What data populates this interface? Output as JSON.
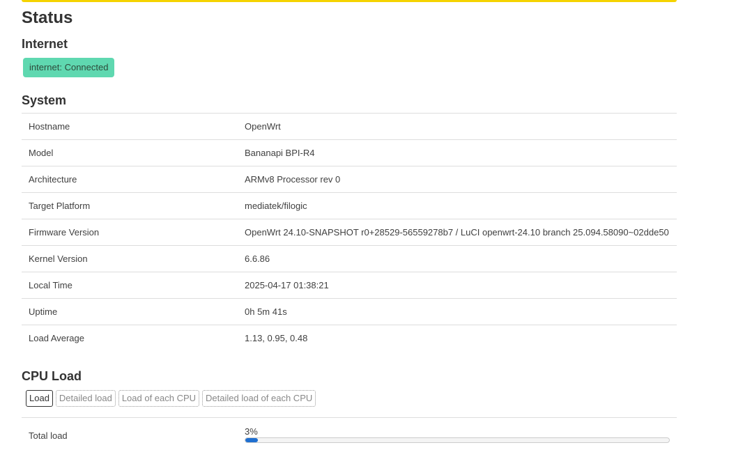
{
  "page": {
    "title": "Status"
  },
  "internet": {
    "heading": "Internet",
    "badge": "internet: Connected",
    "badge_color": "#5fd8b0"
  },
  "system": {
    "heading": "System",
    "rows": [
      {
        "key": "Hostname",
        "value": "OpenWrt"
      },
      {
        "key": "Model",
        "value": "Bananapi BPI-R4"
      },
      {
        "key": "Architecture",
        "value": "ARMv8 Processor rev 0"
      },
      {
        "key": "Target Platform",
        "value": "mediatek/filogic"
      },
      {
        "key": "Firmware Version",
        "value": "OpenWrt 24.10-SNAPSHOT r0+28529-56559278b7 / LuCI openwrt-24.10 branch 25.094.58090~02dde50"
      },
      {
        "key": "Kernel Version",
        "value": "6.6.86"
      },
      {
        "key": "Local Time",
        "value": "2025-04-17 01:38:21"
      },
      {
        "key": "Uptime",
        "value": "0h 5m 41s"
      },
      {
        "key": "Load Average",
        "value": "1.13, 0.95, 0.48"
      }
    ]
  },
  "cpu": {
    "heading": "CPU Load",
    "tabs": [
      "Load",
      "Detailed load",
      "Load of each CPU",
      "Detailed load of each CPU"
    ],
    "active_tab": 0,
    "total_label": "Total load",
    "total_percent_text": "3%",
    "total_fraction": 0.03,
    "bar_color": "#1f6fd0"
  },
  "colors": {
    "accent_stripe": "#f5d300"
  }
}
